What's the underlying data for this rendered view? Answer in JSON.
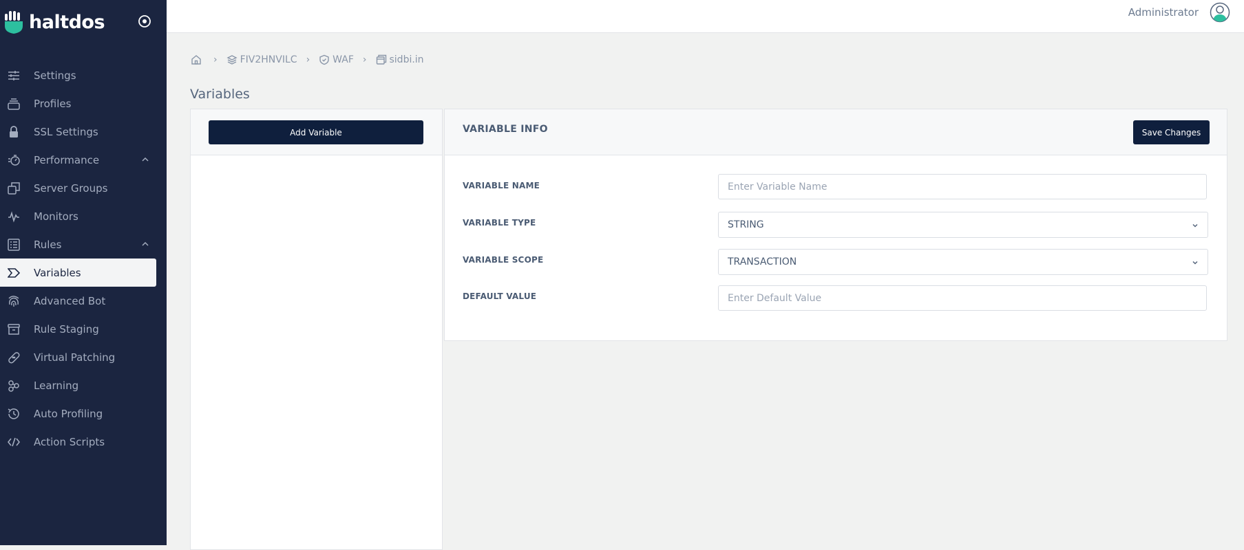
{
  "brand": {
    "name": "haltdos"
  },
  "sidebar": {
    "items": [
      {
        "label": "Settings",
        "icon": "sliders-icon"
      },
      {
        "label": "Profiles",
        "icon": "layers-stack-icon"
      },
      {
        "label": "SSL Settings",
        "icon": "lock-icon"
      },
      {
        "label": "Performance",
        "icon": "speedometer-icon",
        "expanded": true
      },
      {
        "label": "Server Groups",
        "icon": "copy-squares-icon"
      },
      {
        "label": "Monitors",
        "icon": "pulse-icon"
      },
      {
        "label": "Rules",
        "icon": "list-icon",
        "expanded": true
      },
      {
        "label": "Variables",
        "icon": "tag-arrow-icon",
        "active": true
      },
      {
        "label": "Advanced Bot",
        "icon": "fingerprint-icon"
      },
      {
        "label": "Rule Staging",
        "icon": "archive-icon"
      },
      {
        "label": "Virtual Patching",
        "icon": "bandage-icon"
      },
      {
        "label": "Learning",
        "icon": "nodes-icon"
      },
      {
        "label": "Auto Profiling",
        "icon": "history-icon"
      },
      {
        "label": "Action Scripts",
        "icon": "code-icon"
      }
    ]
  },
  "header": {
    "user_name": "Administrator"
  },
  "breadcrumb": {
    "sep": "›",
    "items": [
      {
        "label": "",
        "icon": "home-icon"
      },
      {
        "label": "FIV2HNVILC",
        "icon": "layers-icon"
      },
      {
        "label": "WAF",
        "icon": "shield-icon"
      },
      {
        "label": "sidbi.in",
        "icon": "window-icon"
      }
    ]
  },
  "page": {
    "title": "Variables"
  },
  "left_panel": {
    "add_button": "Add Variable"
  },
  "variable_info": {
    "title": "VARIABLE INFO",
    "save_button": "Save Changes",
    "fields": {
      "name": {
        "label": "VARIABLE NAME",
        "placeholder": "Enter Variable Name",
        "value": ""
      },
      "type": {
        "label": "VARIABLE TYPE",
        "value": "STRING"
      },
      "scope": {
        "label": "VARIABLE SCOPE",
        "value": "TRANSACTION"
      },
      "default": {
        "label": "DEFAULT VALUE",
        "placeholder": "Enter Default Value",
        "value": ""
      }
    }
  },
  "colors": {
    "sidebar_bg": "#1b2540",
    "brand_accent": "#2dbf9f",
    "button_dark": "#0f1f3d",
    "page_bg": "#f1f2f1"
  }
}
